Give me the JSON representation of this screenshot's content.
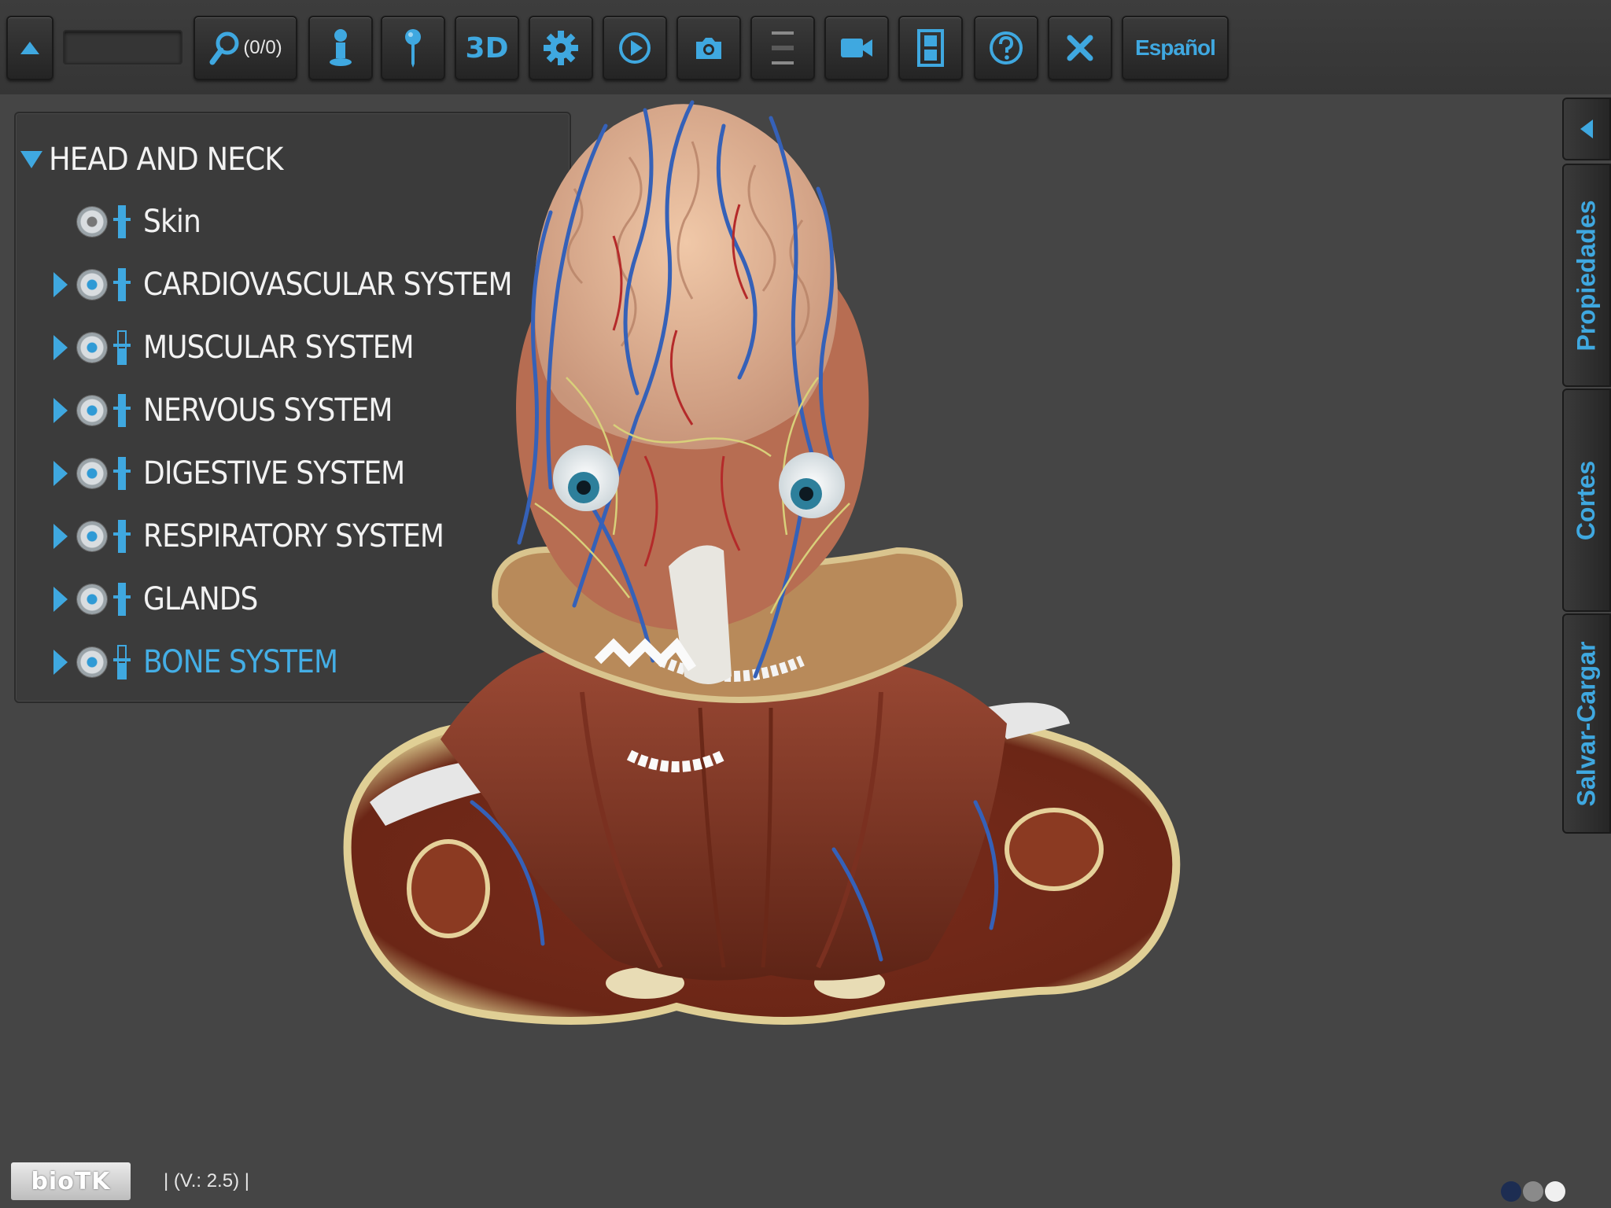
{
  "toolbar": {
    "search_count": "(0/0)",
    "search_placeholder": "",
    "btn_3d": "3D",
    "language": "Español",
    "icons": [
      "up-arrow-icon",
      "search-icon",
      "person-icon",
      "pin-icon",
      "3d-icon",
      "gear-icon",
      "play-icon",
      "camera-icon",
      "slider-icon",
      "video-camera-icon",
      "film-icon",
      "help-icon",
      "close-icon"
    ]
  },
  "tree": {
    "root_label": "HEAD AND NECK",
    "items": [
      {
        "label": "Skin",
        "expandable": false,
        "active": false
      },
      {
        "label": "CARDIOVASCULAR SYSTEM",
        "expandable": true,
        "active": false
      },
      {
        "label": "MUSCULAR SYSTEM",
        "expandable": true,
        "active": false
      },
      {
        "label": "NERVOUS SYSTEM",
        "expandable": true,
        "active": false
      },
      {
        "label": "DIGESTIVE SYSTEM",
        "expandable": true,
        "active": false
      },
      {
        "label": "RESPIRATORY SYSTEM",
        "expandable": true,
        "active": false
      },
      {
        "label": "GLANDS",
        "expandable": true,
        "active": false
      },
      {
        "label": "BONE SYSTEM",
        "expandable": true,
        "active": true
      }
    ]
  },
  "side_tabs": {
    "properties": "Propiedades",
    "cuts": "Cortes",
    "save_load": "Salvar-Cargar"
  },
  "footer": {
    "logo": "bioTK",
    "version": "| (V.: 2.5) |"
  },
  "colors": {
    "accent": "#3fa8e0",
    "background": "#454545",
    "panel": "#3b3b3b"
  }
}
